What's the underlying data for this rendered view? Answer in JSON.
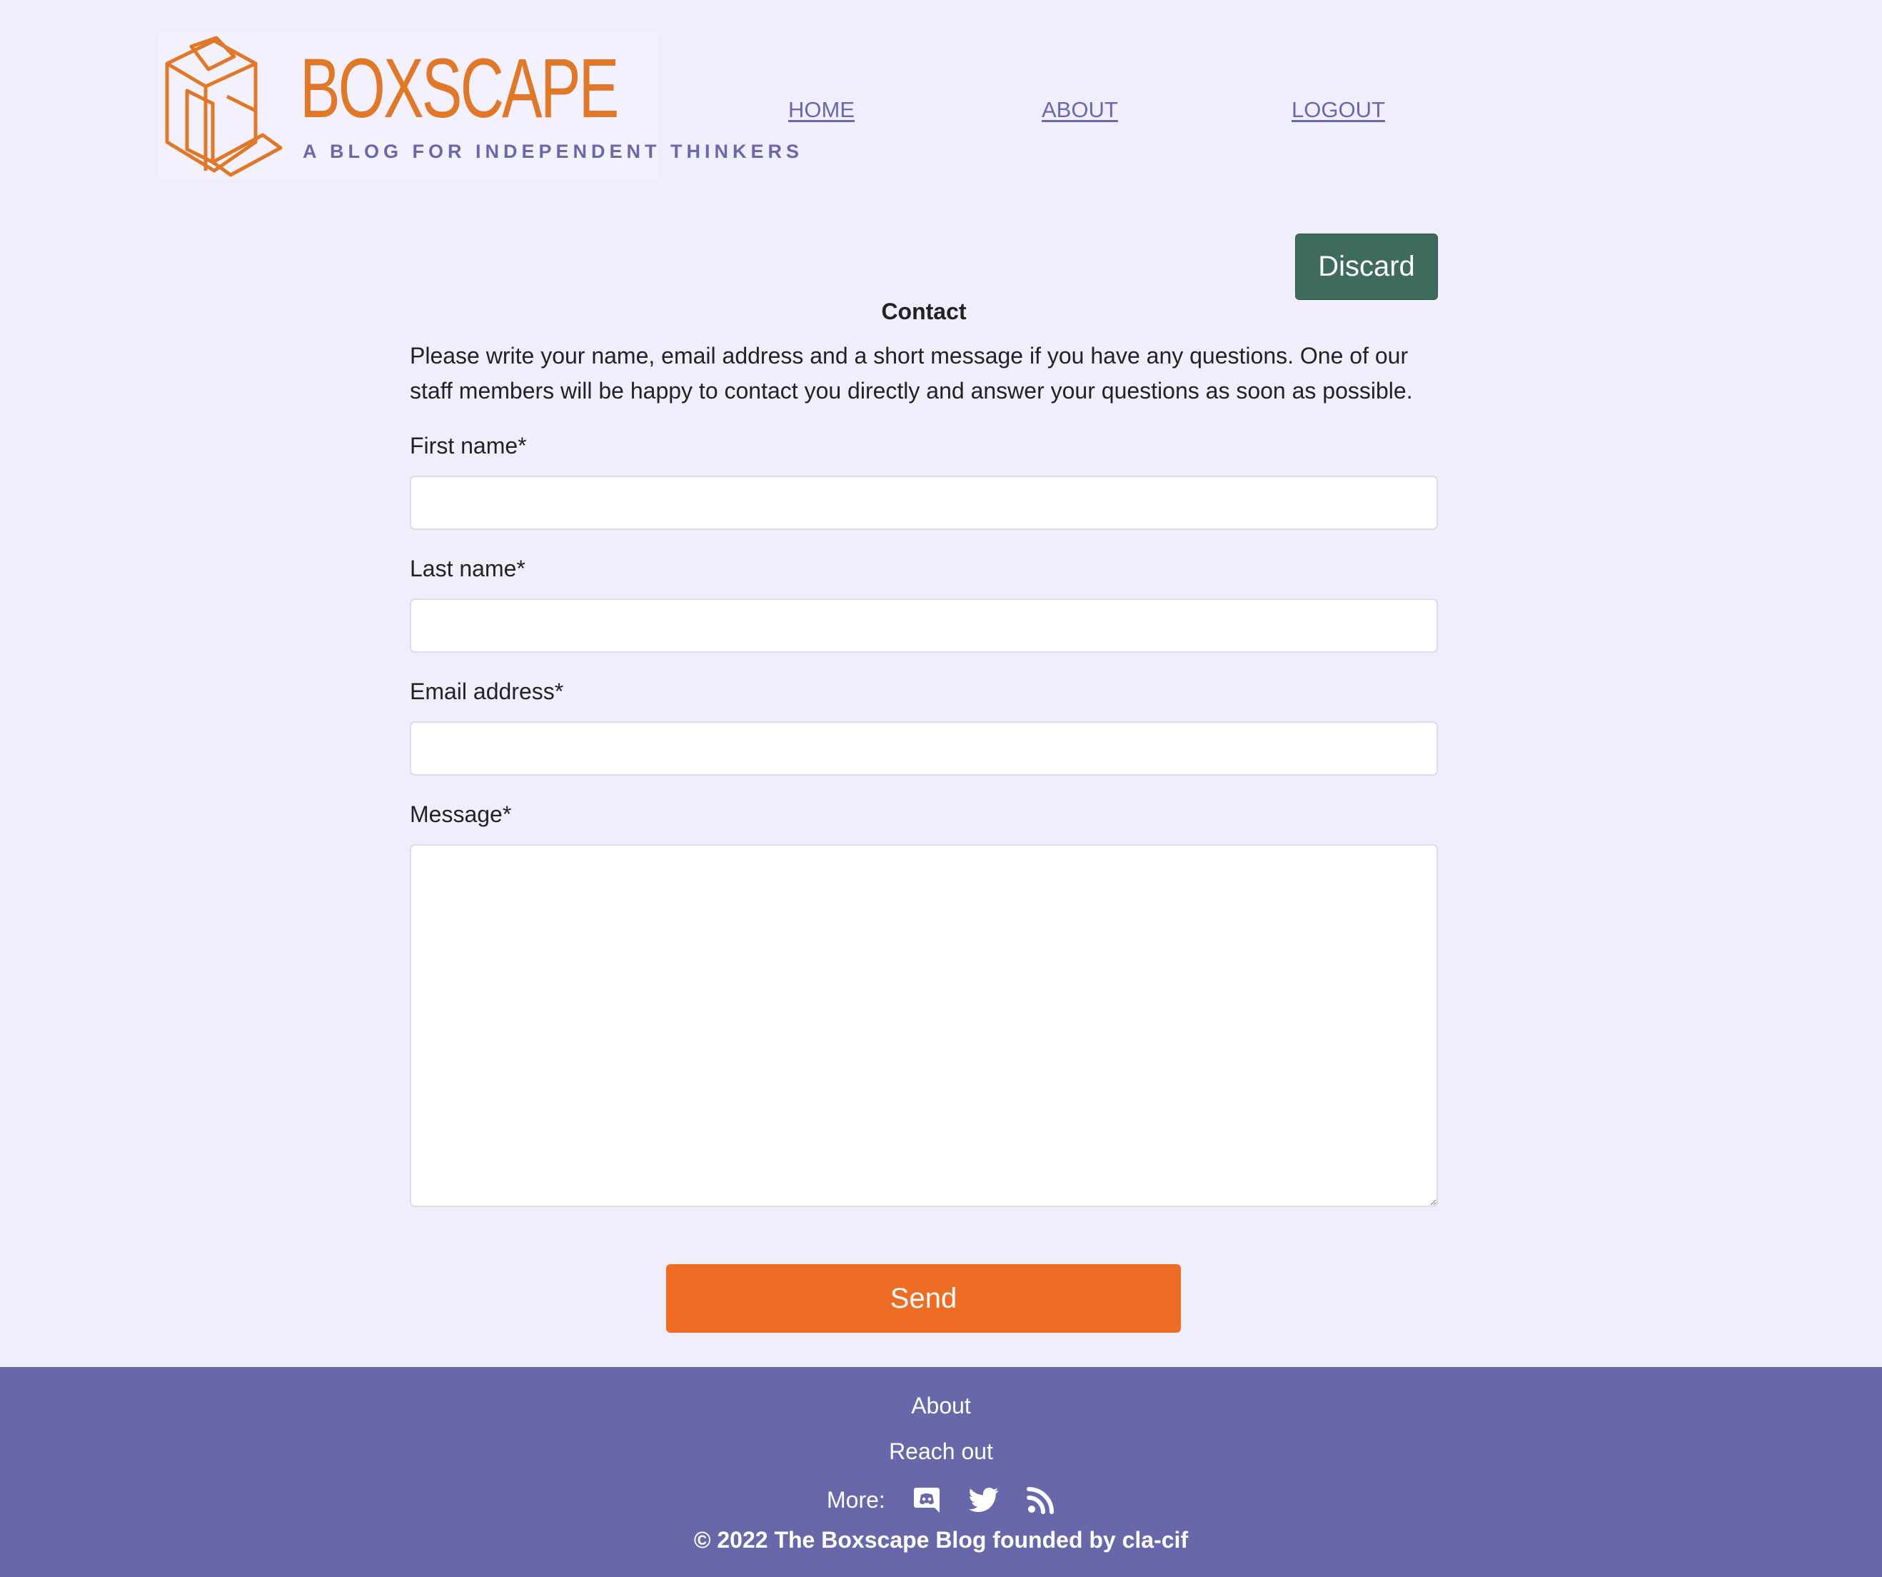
{
  "header": {
    "logo_title": "BOXSCAPE",
    "logo_tagline": "A BLOG FOR INDEPENDENT THINKERS",
    "nav": [
      {
        "label": "HOME"
      },
      {
        "label": "ABOUT"
      },
      {
        "label": "LOGOUT"
      }
    ]
  },
  "form": {
    "discard_label": "Discard",
    "title": "Contact",
    "intro": "Please write your name, email address and a short message if you have any questions. One of our staff members will be happy to contact you directly and answer your questions as soon as possible.",
    "fields": [
      {
        "label": "First name*",
        "value": ""
      },
      {
        "label": "Last name*",
        "value": ""
      },
      {
        "label": "Email address*",
        "value": ""
      },
      {
        "label": "Message*",
        "value": ""
      }
    ],
    "send_label": "Send"
  },
  "footer": {
    "about": "About",
    "reach_out": "Reach out",
    "more_label": "More:",
    "icons": [
      "discord-icon",
      "twitter-icon",
      "rss-icon"
    ],
    "copyright": "© 2022 The Boxscape Blog founded by cla-cif"
  },
  "colors": {
    "background": "#f0eefc",
    "brand_orange": "#e07828",
    "brand_purple": "#6a68ab",
    "discard_green": "#3f6b5a",
    "send_orange": "#ef6c24",
    "footer_purple": "#6767aa"
  }
}
